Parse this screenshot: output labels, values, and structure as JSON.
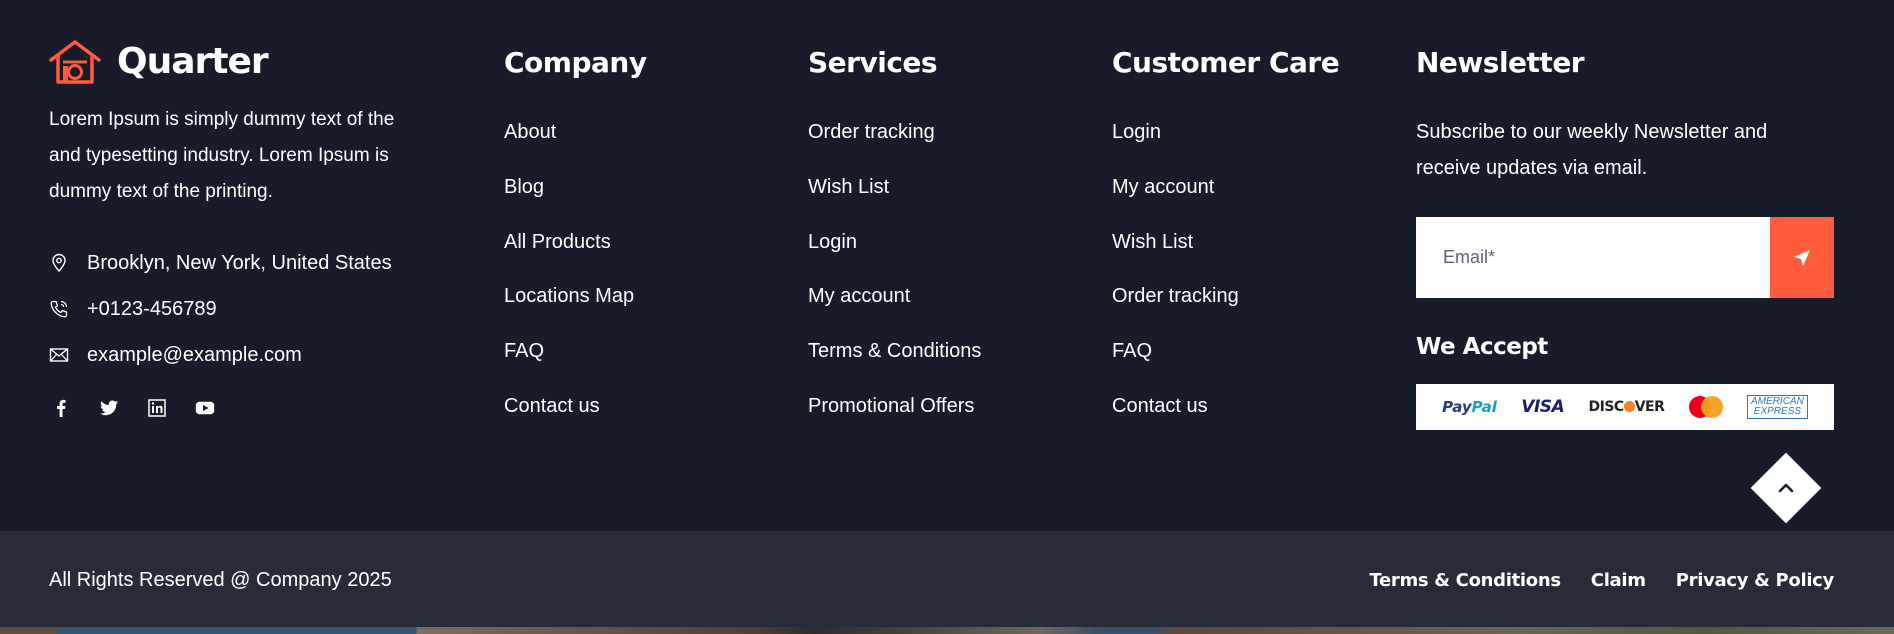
{
  "brand": {
    "name": "Quarter"
  },
  "about": {
    "text": "Lorem Ipsum is simply dummy text of the and typesetting industry. Lorem Ipsum is dummy text of the printing.",
    "address": "Brooklyn, New York, United States",
    "phone": "+0123-456789",
    "email": "example@example.com"
  },
  "company": {
    "title": "Company",
    "links": [
      "About",
      "Blog",
      "All Products",
      "Locations Map",
      "FAQ",
      "Contact us"
    ]
  },
  "services": {
    "title": "Services",
    "links": [
      "Order tracking",
      "Wish List",
      "Login",
      "My account",
      "Terms & Conditions",
      "Promotional Offers"
    ]
  },
  "customer_care": {
    "title": "Customer Care",
    "links": [
      "Login",
      "My account",
      "Wish List",
      "Order tracking",
      "FAQ",
      "Contact us"
    ]
  },
  "newsletter": {
    "title": "Newsletter",
    "text": "Subscribe to our weekly Newsletter and receive updates via email.",
    "email_placeholder": "Email*",
    "accept_title": "We Accept",
    "payments": {
      "paypal_1": "Pay",
      "paypal_2": "Pal",
      "visa": "VISA",
      "discover_1": "DISC",
      "discover_2": "VER",
      "amex_1": "AMERICAN",
      "amex_2": "EXPRESS"
    }
  },
  "bottom": {
    "copyright": "All Rights Reserved @ Company 2025",
    "links": [
      "Terms & Conditions",
      "Claim",
      "Privacy & Policy"
    ]
  },
  "colors": {
    "background": "#171b2a",
    "bottom_bar": "#282c39",
    "accent": "#ff5a3c"
  }
}
